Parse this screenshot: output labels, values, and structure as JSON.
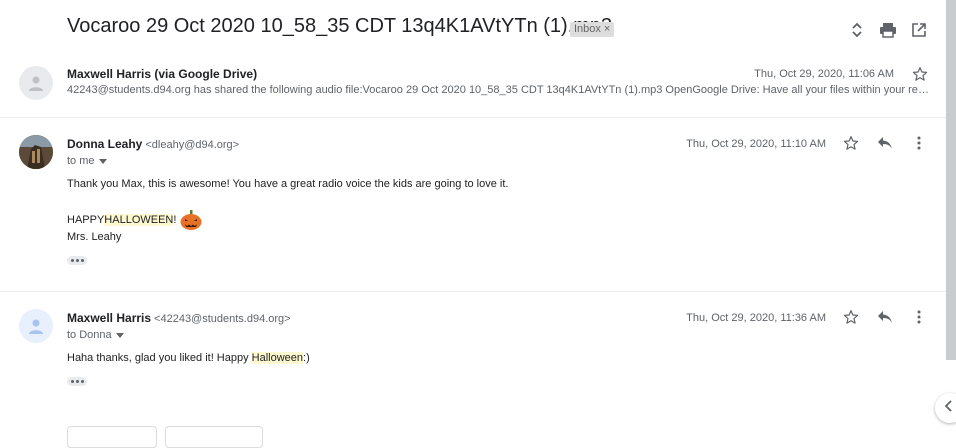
{
  "thread": {
    "subject": "Vocaroo 29 Oct 2020 10_58_35 CDT 13q4K1AVtYTn (1).mp3",
    "label": "Inbox",
    "label_close": "×"
  },
  "messages": [
    {
      "sender": "Maxwell Harris (via Google Drive)",
      "date": "Thu, Oct 29, 2020, 11:06 AM",
      "snippet": "42243@students.d94.org has shared the following audio file:Vocaroo 29 Oct 2020 10_58_35 CDT 13q4K1AVtYTn (1).mp3 OpenGoogle Drive: Have all your files within your reach from any device."
    },
    {
      "sender": "Donna Leahy",
      "email": "<dleahy@d94.org>",
      "to": "to me",
      "date": "Thu, Oct 29, 2020, 11:10 AM",
      "line1": "Thank you Max, this is awesome!  You have a great radio voice the kids are going to love it.",
      "happy": "HAPPY ",
      "halloween": "HALLOWEEN",
      "bang": "!",
      "signature": "Mrs. Leahy"
    },
    {
      "sender": "Maxwell Harris",
      "email": "<42243@students.d94.org>",
      "to": "to Donna",
      "date": "Thu, Oct 29, 2020, 11:36 AM",
      "line_prefix": "Haha thanks, glad you liked it! Happy ",
      "halloween": "Halloween",
      "line_suffix": ":)"
    }
  ],
  "icons": {
    "expand": "unfold-icon",
    "print": "print-icon",
    "open_new": "open-in-new-window-icon",
    "star": "star-icon",
    "reply": "reply-icon",
    "more": "more-vert-icon",
    "side": "chevron-left-icon"
  },
  "colors": {
    "highlight": "#fcf8d0",
    "pumpkin": "#e8712a"
  }
}
